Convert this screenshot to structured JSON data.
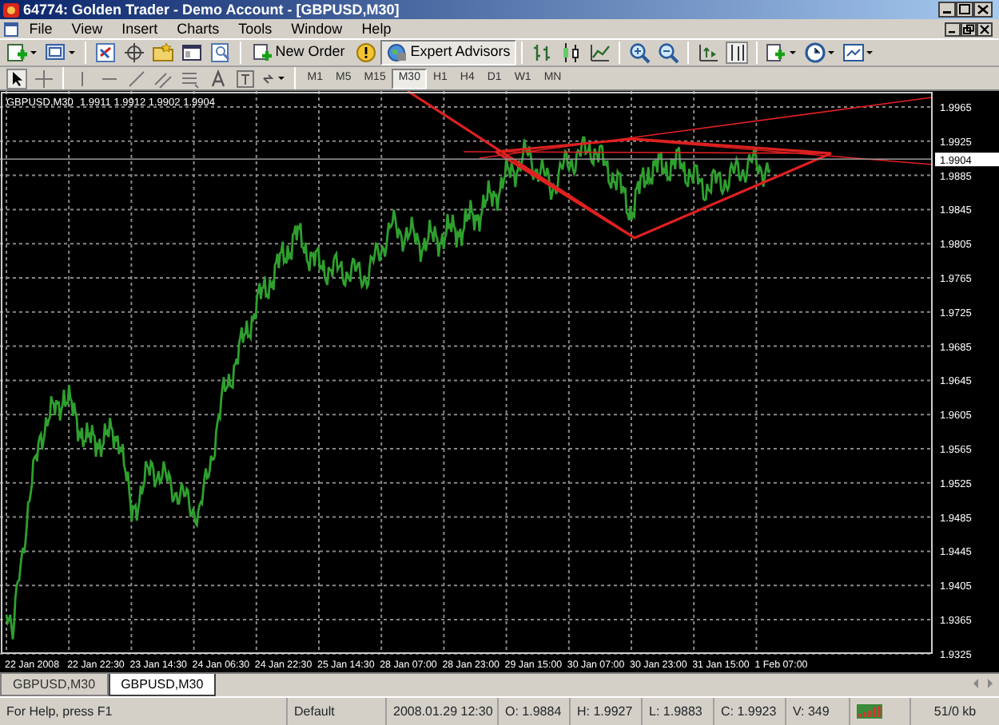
{
  "window": {
    "title": "64774: Golden Trader - Demo Account - [GBPUSD,M30]"
  },
  "menu": [
    "File",
    "View",
    "Insert",
    "Charts",
    "Tools",
    "Window",
    "Help"
  ],
  "toolbar_buttons": [
    {
      "label": "New Order",
      "pressed": false
    },
    {
      "label": "Expert Advisors",
      "pressed": true
    }
  ],
  "timeframes": [
    {
      "label": "M1",
      "selected": false
    },
    {
      "label": "M5",
      "selected": false
    },
    {
      "label": "M15",
      "selected": false
    },
    {
      "label": "M30",
      "selected": true
    },
    {
      "label": "H1",
      "selected": false
    },
    {
      "label": "H4",
      "selected": false
    },
    {
      "label": "D1",
      "selected": false
    },
    {
      "label": "W1",
      "selected": false
    },
    {
      "label": "MN",
      "selected": false
    }
  ],
  "chart": {
    "symbol": "GBPUSD,M30",
    "quote": "1.9911 1.9912 1.9902 1.9904",
    "current_price": "1.9904",
    "price_labels": [
      "1.9965",
      "1.9925",
      "1.9885",
      "1.9845",
      "1.9805",
      "1.9765",
      "1.9725",
      "1.9685",
      "1.9645",
      "1.9605",
      "1.9565",
      "1.9525",
      "1.9485",
      "1.9445",
      "1.9405",
      "1.9365",
      "1.9325"
    ],
    "time_labels": [
      "22 Jan 2008",
      "22 Jan 22:30",
      "23 Jan 14:30",
      "24 Jan 06:30",
      "24 Jan 22:30",
      "25 Jan 14:30",
      "28 Jan 07:00",
      "28 Jan 23:00",
      "29 Jan 15:00",
      "30 Jan 07:00",
      "30 Jan 23:00",
      "31 Jan 15:00",
      "1 Feb 07:00"
    ]
  },
  "tabs": [
    {
      "label": "GBPUSD,M30",
      "selected": false
    },
    {
      "label": "GBPUSD,M30",
      "selected": true
    }
  ],
  "status_bar": {
    "help": "For Help, press F1",
    "profile": "Default",
    "time": "2008.01.29 12:30",
    "open": "O: 1.9884",
    "high": "H: 1.9927",
    "low": "L: 1.9883",
    "close": "C: 1.9923",
    "volume": "V: 349",
    "traffic": "51/0 kb"
  }
}
